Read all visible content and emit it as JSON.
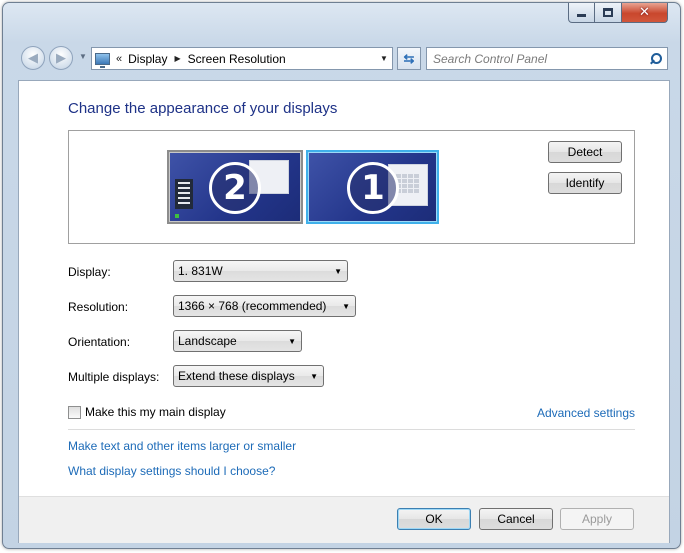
{
  "window": {
    "controls": {
      "minimize": "minimize",
      "maximize": "maximize",
      "close": "✕"
    }
  },
  "nav": {
    "address": {
      "chevron": "«",
      "crumbs": [
        "Display",
        "Screen Resolution"
      ]
    },
    "search": {
      "placeholder": "Search Control Panel"
    }
  },
  "main": {
    "heading": "Change the appearance of your displays",
    "monitors": [
      {
        "number": "2",
        "selected": false
      },
      {
        "number": "1",
        "selected": true
      }
    ],
    "detect_label": "Detect",
    "identify_label": "Identify",
    "fields": {
      "display": {
        "label": "Display:",
        "value": "1. 831W"
      },
      "resolution": {
        "label": "Resolution:",
        "value": "1366 × 768 (recommended)"
      },
      "orientation": {
        "label": "Orientation:",
        "value": "Landscape"
      },
      "multiple": {
        "label": "Multiple displays:",
        "value": "Extend these displays"
      }
    },
    "main_display_checkbox": {
      "label": "Make this my main display",
      "checked": false
    },
    "advanced_link": "Advanced settings",
    "links": [
      "Make text and other items larger or smaller",
      "What display settings should I choose?"
    ]
  },
  "footer": {
    "ok": "OK",
    "cancel": "Cancel",
    "apply": "Apply"
  },
  "colors": {
    "link": "#1d6bb8",
    "heading": "#1e3287",
    "close_button": "#c9472d"
  }
}
